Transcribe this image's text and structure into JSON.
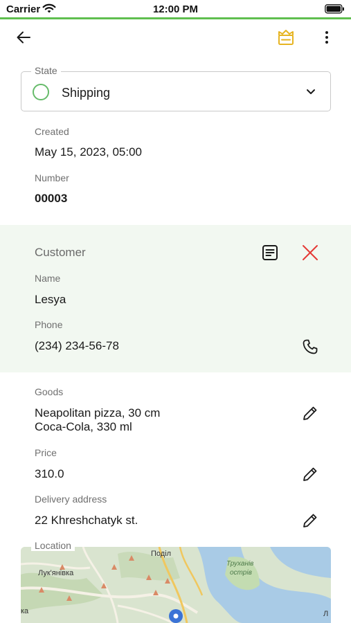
{
  "status_bar": {
    "carrier": "Carrier",
    "time": "12:00 PM"
  },
  "appbar": {
    "icons": [
      "back-arrow-icon",
      "crown-icon",
      "more-vertical-icon"
    ],
    "accent": "#e6b422"
  },
  "state": {
    "label": "State",
    "value": "Shipping",
    "indicator_color": "#66bb6a"
  },
  "created": {
    "label": "Created",
    "value": "May 15, 2023, 05:00"
  },
  "number": {
    "label": "Number",
    "value": "00003"
  },
  "customer": {
    "title": "Customer",
    "name_label": "Name",
    "name": "Lesya",
    "phone_label": "Phone",
    "phone": "(234) 234-56-78",
    "background": "#f2f8f1",
    "close_color": "#e53935"
  },
  "goods": {
    "label": "Goods",
    "items": [
      "Neapolitan pizza, 30 cm",
      "Coca-Cola, 330 ml"
    ]
  },
  "price": {
    "label": "Price",
    "value": "310.0"
  },
  "delivery": {
    "label": "Delivery address",
    "value": "22 Khreshchatyk st."
  },
  "location": {
    "label": "Location",
    "map_labels": {
      "podil": "Поділ",
      "lukianivka": "Лук'янівка",
      "trukhaniv_1": "Труханів",
      "trukhaniv_2": "острів",
      "left_edge": "ка",
      "right_edge": "Л"
    }
  }
}
